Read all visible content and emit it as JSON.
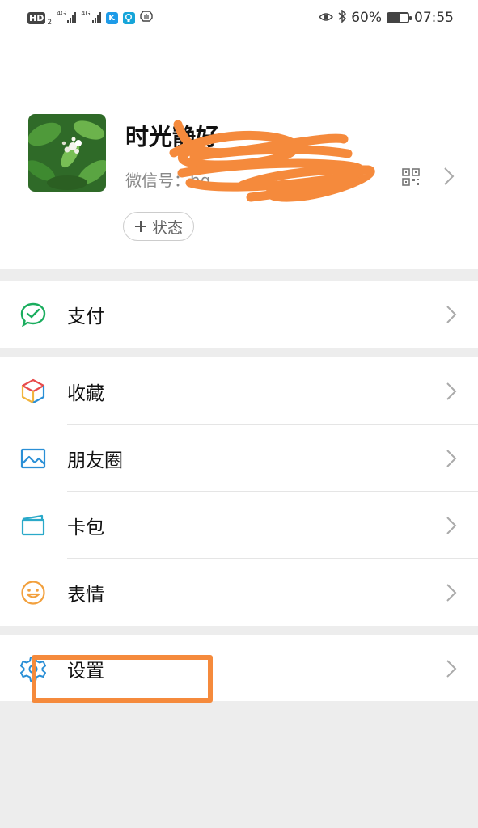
{
  "status_bar": {
    "hd": "HD",
    "hd_sub": "2",
    "net1": "4G",
    "net2": "4G",
    "battery": "60%",
    "battery_level": 0.6,
    "time": "07:55"
  },
  "profile": {
    "nickname": "时光静好",
    "wechat_id": "微信号：hq...",
    "status_button": "状态",
    "status_button_icon": "plus-icon"
  },
  "menu": {
    "pay": {
      "label": "支付",
      "icon": "wallet-check-icon"
    },
    "favorites": {
      "label": "收藏",
      "icon": "cube-icon"
    },
    "moments": {
      "label": "朋友圈",
      "icon": "picture-icon"
    },
    "cards": {
      "label": "卡包",
      "icon": "card-wallet-icon"
    },
    "stickers": {
      "label": "表情",
      "icon": "smiley-icon"
    },
    "settings": {
      "label": "设置",
      "icon": "gear-icon"
    }
  },
  "colors": {
    "accent_green": "#1aad5e",
    "annotation_orange": "#f58a3c",
    "icon_blue": "#2a8fd6",
    "icon_orange": "#f2a03d"
  }
}
